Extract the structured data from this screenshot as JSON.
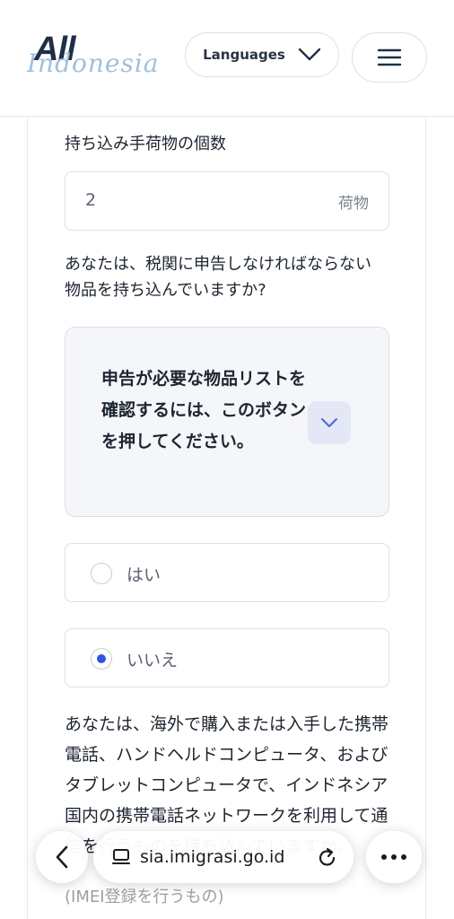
{
  "header": {
    "logo_line1": "All",
    "logo_line2": "Indonesia",
    "languages_label": "Languages"
  },
  "form": {
    "baggage_label": "持ち込み手荷物の個数",
    "baggage_value": "2",
    "baggage_unit": "荷物",
    "customs_question_line1": "あなたは、税関に申告しなければならない",
    "customs_question_line2": "物品を持ち込んでいますか?",
    "info_box_text": "申告が必要な物品リストを確認するには、このボタンを押してください。",
    "options": [
      {
        "label": "はい",
        "selected": false
      },
      {
        "label": "いいえ",
        "selected": true
      }
    ],
    "device_question": "あなたは、海外で購入または入手した携帯電話、ハンドヘルドコンピュータ、およびタブレットコンピュータで、インドネシア国内の携帯電話ネットワークを利用して通信を行うものを持ち込んでいますか。",
    "device_question_tail": "(IMEI登録を行うもの)"
  },
  "browser": {
    "url": "sia.imigrasi.go.id"
  },
  "colors": {
    "accent": "#2f55e0",
    "border": "#dcdfe4",
    "info_bg": "#f5f6fa"
  }
}
